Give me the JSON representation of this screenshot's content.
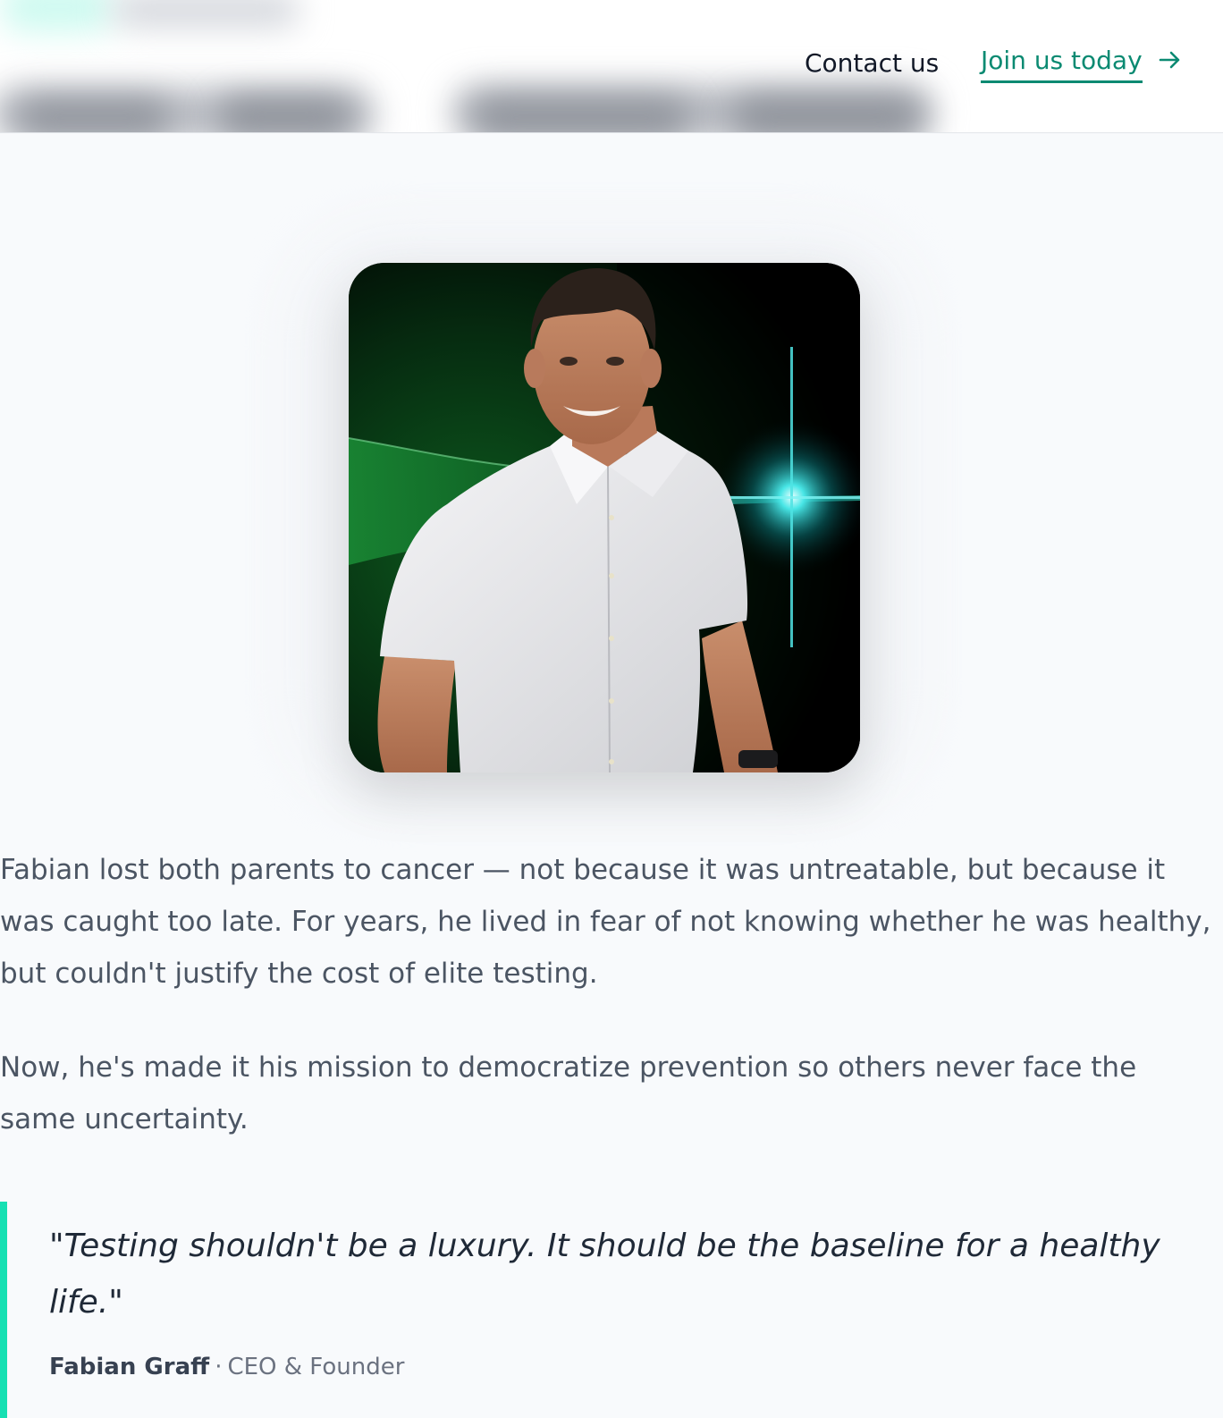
{
  "header": {
    "contact_label": "Contact us",
    "join_label": "Join us today",
    "accent_color": "#0b8a72"
  },
  "portrait": {
    "icon": "founder-portrait"
  },
  "story": {
    "paragraphs": [
      "Fabian lost both parents to cancer — not because it was untreatable, but because it was caught too late. For years, he lived in fear of not knowing whether he was healthy, but couldn't justify the cost of elite testing.",
      "Now, he's made it his mission to democratize prevention so others never face the same uncertainty."
    ]
  },
  "quote": {
    "text": "\"Testing shouldn't be a luxury. It should be the baseline for a healthy life.\"",
    "author": "Fabian Graff",
    "separator": "·",
    "role": "CEO & Founder",
    "accent_color": "#16e0b3"
  }
}
